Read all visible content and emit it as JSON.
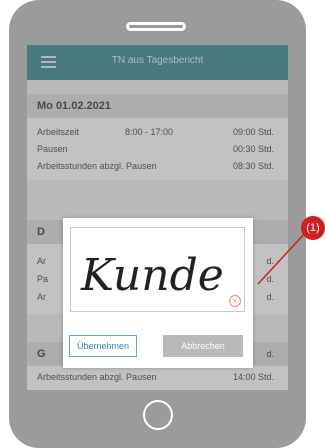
{
  "app": {
    "title": "TN aus Tagesbericht"
  },
  "days": [
    {
      "date": "Mo 01.02.2021",
      "rows": [
        {
          "label": "Arbeitszeit",
          "time": "8:00 - 17:00",
          "value": "09:00 Std."
        },
        {
          "label": "Pausen",
          "time": "",
          "value": "00:30 Std."
        },
        {
          "label": "Arbeitsstunden abzgl. Pausen",
          "time": "",
          "value": "08:30 Std."
        }
      ]
    }
  ],
  "partial_day": {
    "date_visible": "D",
    "row_prefixes": [
      "Ar",
      "Pa",
      "Ar"
    ],
    "row_suffixes": [
      "d.",
      "d.",
      "d."
    ]
  },
  "summary": {
    "header_visible": "G",
    "header_suffix": "d.",
    "label": "Arbeitsstunden abzgl. Pausen",
    "value": "14:00 Std."
  },
  "dialog": {
    "signature_text": "Kunde",
    "clear_symbol": "×",
    "accept_label": "Übernehmen",
    "cancel_label": "Abbrechen"
  },
  "annotation": {
    "label": "(1)"
  },
  "colors": {
    "app_bar": "#1f7a86",
    "phone_frame": "#9b9b9b",
    "callout": "#cf1f1f",
    "accept_border": "#6aa2c8",
    "cancel_bg": "#b9b9b9"
  },
  "icons": [
    "hamburger-menu-icon",
    "clear-signature-icon",
    "home-button-icon"
  ]
}
